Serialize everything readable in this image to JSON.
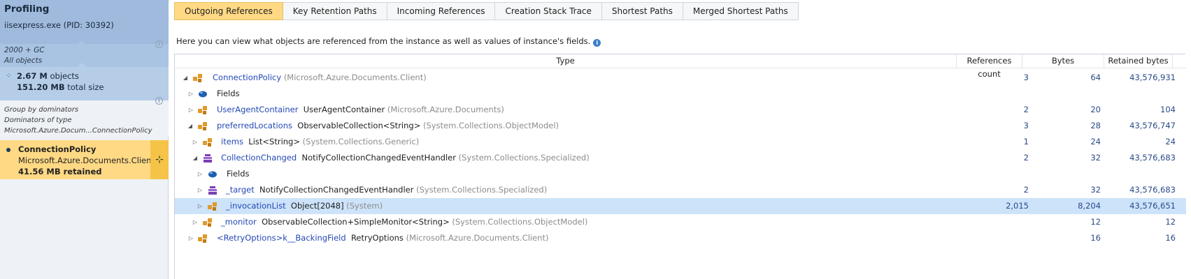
{
  "sidebar": {
    "title": "Profiling",
    "process": "iisexpress.exe (PID: 30392)",
    "filter_line1": "2000 + GC",
    "filter_line2": "All objects",
    "objects_value": "2.67 M",
    "objects_label": "objects",
    "size_value": "151.20 MB",
    "size_label": "total size",
    "group_line1": "Group by dominators",
    "group_line2": "Dominators of type",
    "group_line3": "Microsoft.Azure.Docum...ConnectionPolicy",
    "selected_name": "ConnectionPolicy",
    "selected_namespace": "Microsoft.Azure.Documents.Client",
    "selected_retained": "41.56 MB retained"
  },
  "tabs": [
    {
      "label": "Outgoing References",
      "active": true
    },
    {
      "label": "Key Retention Paths",
      "active": false
    },
    {
      "label": "Incoming References",
      "active": false
    },
    {
      "label": "Creation Stack Trace",
      "active": false
    },
    {
      "label": "Shortest Paths",
      "active": false
    },
    {
      "label": "Merged Shortest Paths",
      "active": false
    }
  ],
  "description": "Here you can view what objects are referenced from the instance as well as values of instance's fields.",
  "columns": {
    "type": "Type",
    "refs": "References count",
    "bytes": "Bytes",
    "retained": "Retained bytes"
  },
  "rows": [
    {
      "field": "",
      "type": "ConnectionPolicy",
      "ns": "(Microsoft.Azure.Documents.Client)",
      "refs": "3",
      "bytes": "64",
      "retained": "43,576,931"
    },
    {
      "field": "",
      "type": "Fields",
      "ns": "",
      "refs": "",
      "bytes": "",
      "retained": ""
    },
    {
      "field": "UserAgentContainer",
      "type": "UserAgentContainer",
      "ns": "(Microsoft.Azure.Documents)",
      "refs": "2",
      "bytes": "20",
      "retained": "104"
    },
    {
      "field": "preferredLocations",
      "type": "ObservableCollection<String>",
      "ns": "(System.Collections.ObjectModel)",
      "refs": "3",
      "bytes": "28",
      "retained": "43,576,747"
    },
    {
      "field": "items",
      "type": "List<String>",
      "ns": "(System.Collections.Generic)",
      "refs": "1",
      "bytes": "24",
      "retained": "24"
    },
    {
      "field": "CollectionChanged",
      "type": "NotifyCollectionChangedEventHandler",
      "ns": "(System.Collections.Specialized)",
      "refs": "2",
      "bytes": "32",
      "retained": "43,576,683"
    },
    {
      "field": "",
      "type": "Fields",
      "ns": "",
      "refs": "",
      "bytes": "",
      "retained": ""
    },
    {
      "field": "_target",
      "type": "NotifyCollectionChangedEventHandler",
      "ns": "(System.Collections.Specialized)",
      "refs": "2",
      "bytes": "32",
      "retained": "43,576,683"
    },
    {
      "field": "_invocationList",
      "type": "Object[2048]",
      "ns": "(System)",
      "refs": "2,015",
      "bytes": "8,204",
      "retained": "43,576,651"
    },
    {
      "field": "_monitor",
      "type": "ObservableCollection+SimpleMonitor<String>",
      "ns": "(System.Collections.ObjectModel)",
      "refs": "",
      "bytes": "12",
      "retained": "12"
    },
    {
      "field": "<RetryOptions>k__BackingField",
      "type": "RetryOptions",
      "ns": "(Microsoft.Azure.Documents.Client)",
      "refs": "",
      "bytes": "16",
      "retained": "16"
    }
  ]
}
